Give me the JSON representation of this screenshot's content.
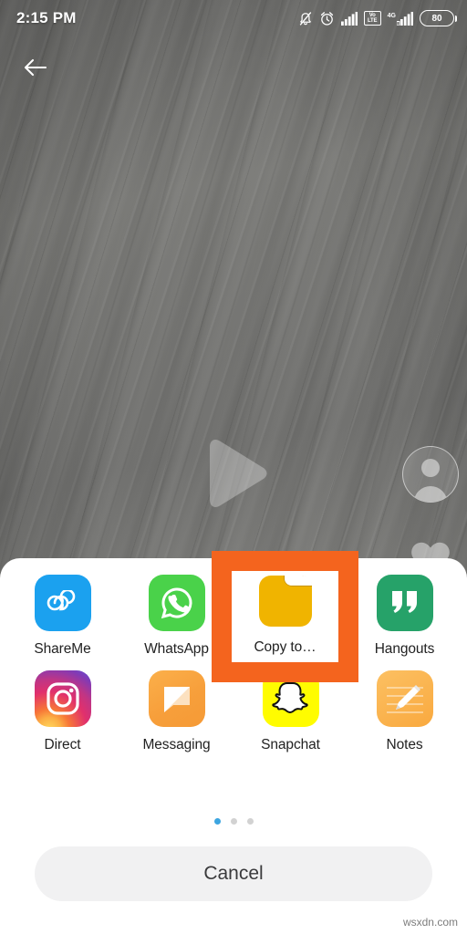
{
  "statusbar": {
    "time": "2:15 PM",
    "icons": [
      {
        "name": "notifications-muted-icon",
        "label": "silent"
      },
      {
        "name": "alarm-icon",
        "label": "alarm"
      },
      {
        "name": "signal-bars-icon",
        "label": "signal"
      },
      {
        "name": "volte-icon",
        "label_top": "Vo",
        "label_bottom": "LTE"
      },
      {
        "name": "network-4g-icon",
        "label": "4G"
      },
      {
        "name": "battery-icon",
        "level": "80"
      }
    ],
    "battery_level": "80",
    "volte_top": "Vo",
    "volte_bottom": "LTE",
    "network_label": "4G"
  },
  "navigation": {
    "back_label": "Back"
  },
  "player": {
    "play_label": "Play",
    "avatar_label": "Profile",
    "like_label": "Like"
  },
  "share_sheet": {
    "rows": [
      [
        {
          "label": "ShareMe",
          "icon": "shareme-icon"
        },
        {
          "label": "WhatsApp",
          "icon": "whatsapp-icon"
        },
        {
          "label": "Copy to…",
          "icon": "copy-to-folder-icon"
        },
        {
          "label": "Hangouts",
          "icon": "hangouts-icon"
        }
      ],
      [
        {
          "label": "Direct",
          "icon": "instagram-direct-icon"
        },
        {
          "label": "Messaging",
          "icon": "messaging-icon"
        },
        {
          "label": "Snapchat",
          "icon": "snapchat-icon"
        },
        {
          "label": "Notes",
          "icon": "notes-icon"
        }
      ]
    ],
    "highlighted": {
      "label": "Copy to…",
      "icon": "copy-to-folder-icon"
    },
    "pagination": {
      "count": 3,
      "active_index": 0
    },
    "cancel_label": "Cancel"
  },
  "annotation": {
    "color": "#f4641e",
    "target": "Copy to…"
  },
  "watermark": "wsxdn.com"
}
